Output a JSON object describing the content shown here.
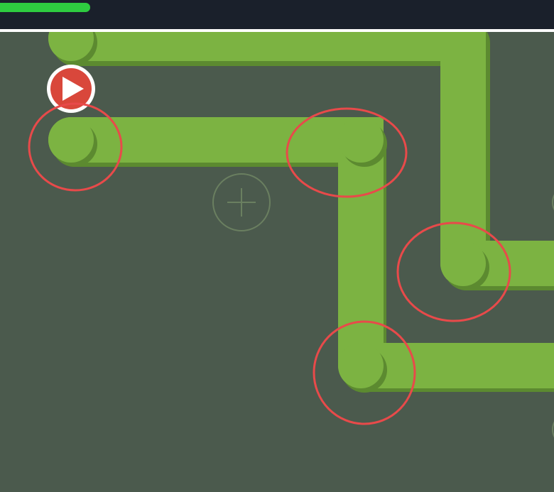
{
  "game": {
    "progress_fraction": 0.163,
    "colors": {
      "background": "#4b5a4d",
      "topbar": "#1a202b",
      "progress": "#2ecc40",
      "path": "#7cb342",
      "path_shadow": "#5c8a30",
      "start_marker": "#d9473b",
      "annotation": "#e84a4a",
      "add_button": "#6a7f60"
    },
    "icons": {
      "start_marker": "play-icon",
      "add_tile": "plus-icon"
    }
  }
}
